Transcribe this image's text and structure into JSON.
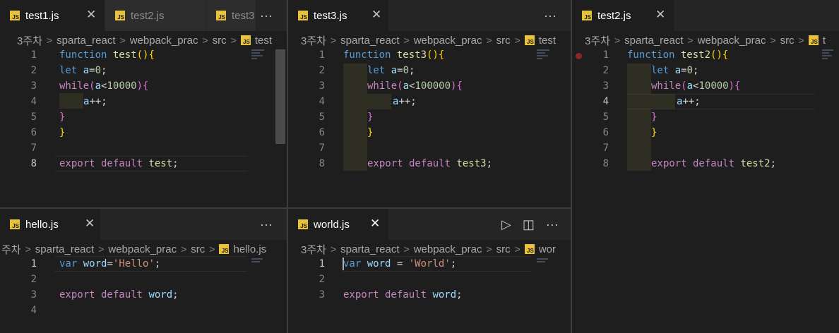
{
  "path": [
    "3주차",
    "sparta_react",
    "webpack_prac",
    "src"
  ],
  "icons": {
    "file_type": "js-icon",
    "close": "close-icon",
    "more": "more-actions-icon",
    "run": "run-icon",
    "split": "split-editor-icon",
    "chevron": "chevron-right-icon"
  },
  "file_icon_text": "JS",
  "colors": {
    "keyword": "#c586c0",
    "function_keyword": "#569cd6",
    "function_name": "#dcdcaa",
    "variable": "#9cdcfe",
    "number": "#b5cea8",
    "string": "#ce9178",
    "breakpoint": "#8a2727"
  },
  "pane1": {
    "tabs": [
      "test1.js",
      "test2.js",
      "test3"
    ],
    "crumb_file": "test",
    "code": {
      "l1_kw": "function",
      "l1_name": "test",
      "l1_open": "(){",
      "l2_kw": "let",
      "l2_var": "a",
      "l2_eq": "=",
      "l2_num": "0",
      "l2_end": ";",
      "l3_kw": "while",
      "l3_open": "(",
      "l3_var": "a",
      "l3_lt": "<",
      "l3_num": "10000",
      "l3_close": "){",
      "l4_var": "a",
      "l4_op": "++;",
      "l5": "}",
      "l6": "}",
      "l8_kw": "export default",
      "l8_name": "test",
      "l8_end": ";"
    }
  },
  "pane2": {
    "tabs": [
      "test3.js"
    ],
    "crumb_file": "test",
    "code": {
      "l1_kw": "function",
      "l1_name": "test3",
      "l1_open": "(){",
      "l2_kw": "let",
      "l2_var": "a",
      "l2_eq": "=",
      "l2_num": "0",
      "l2_end": ";",
      "l3_kw": "while",
      "l3_open": "(",
      "l3_var": "a",
      "l3_lt": "<",
      "l3_num": "100000",
      "l3_close": "){",
      "l4_var": "a",
      "l4_op": "++;",
      "l5": "}",
      "l6": "}",
      "l8_kw": "export default",
      "l8_name": "test3",
      "l8_end": ";"
    }
  },
  "pane3": {
    "tabs": [
      "test2.js"
    ],
    "crumb_file": "t",
    "code": {
      "l1_kw": "function",
      "l1_name": "test2",
      "l1_open": "(){",
      "l2_kw": "let",
      "l2_var": "a",
      "l2_eq": "=",
      "l2_num": "0",
      "l2_end": ";",
      "l3_kw": "while",
      "l3_open": "(",
      "l3_var": "a",
      "l3_lt": "<",
      "l3_num": "10000",
      "l3_close": "){",
      "l4_var": "a",
      "l4_op": "++;",
      "l5": "}",
      "l6": "}",
      "l8_kw": "export default",
      "l8_name": "test2",
      "l8_end": ";"
    }
  },
  "pane4": {
    "tabs": [
      "hello.js"
    ],
    "crumb_lead": "주차",
    "crumb_file": "hello.js",
    "code": {
      "l1_kw": "var",
      "l1_var": "word",
      "l1_eq": "=",
      "l1_str": "'Hello'",
      "l1_end": ";",
      "l3_kw": "export default",
      "l3_var": "word",
      "l3_end": ";"
    }
  },
  "pane5": {
    "tabs": [
      "world.js"
    ],
    "crumb_file": "wor",
    "code": {
      "l1_kw": "var",
      "l1_var": "word",
      "l1_eq": " = ",
      "l1_str": "'World'",
      "l1_end": ";",
      "l3_kw": "export default",
      "l3_var": "word",
      "l3_end": ";"
    }
  },
  "line_numbers": {
    "n1": "1",
    "n2": "2",
    "n3": "3",
    "n4": "4",
    "n5": "5",
    "n6": "6",
    "n7": "7",
    "n8": "8"
  },
  "actions": {
    "more": "···",
    "close": "✕",
    "sep": ">",
    "run": "▷",
    "split": "◫"
  }
}
